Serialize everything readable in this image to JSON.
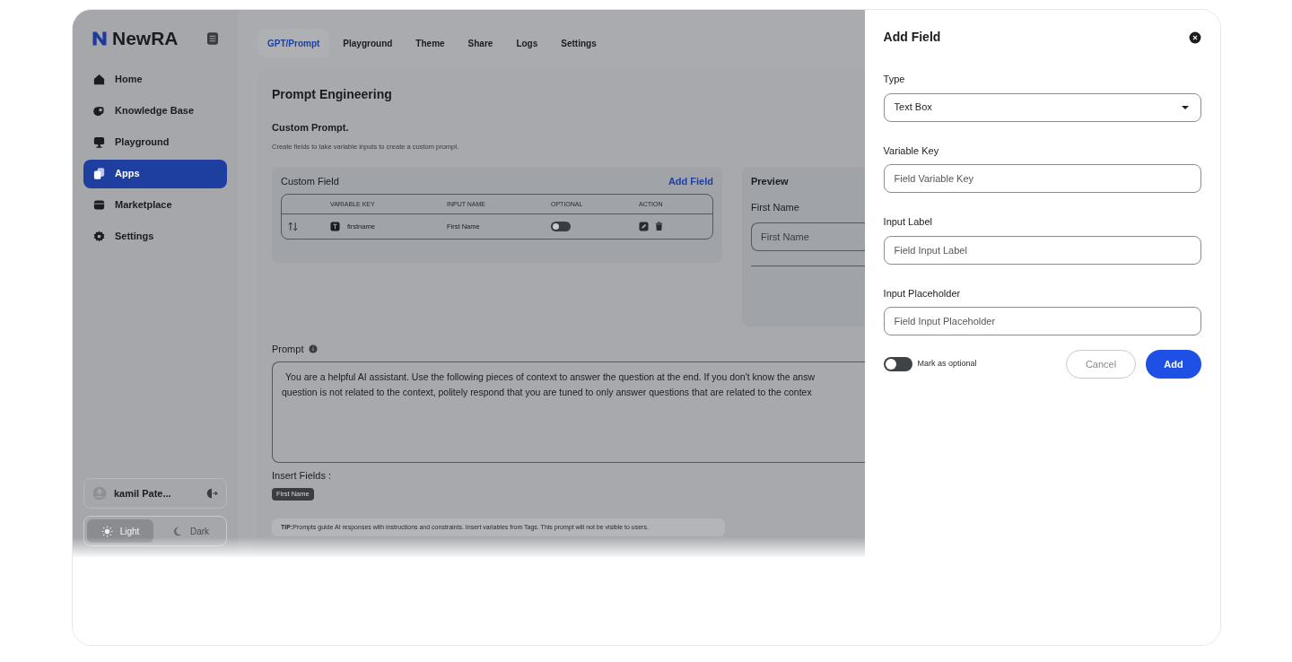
{
  "brand": {
    "name": "NewRA"
  },
  "sidebar": {
    "items": [
      {
        "label": "Home",
        "kind": "home",
        "selected": false
      },
      {
        "label": "Knowledge Base",
        "kind": "book",
        "selected": false
      },
      {
        "label": "Playground",
        "kind": "chat",
        "selected": false
      },
      {
        "label": "Apps",
        "kind": "apps",
        "selected": true
      },
      {
        "label": "Marketplace",
        "kind": "store",
        "selected": false
      },
      {
        "label": "Settings",
        "kind": "gear",
        "selected": false
      }
    ]
  },
  "user": {
    "name": "kamil Pate..."
  },
  "theme_toggle": [
    {
      "label": "Light",
      "kind": "sun",
      "selected": true
    },
    {
      "label": "Dark",
      "kind": "moon",
      "selected": false
    }
  ],
  "tabs": [
    {
      "label": "GPT/Prompt",
      "selected": true
    },
    {
      "label": "Playground",
      "selected": false
    },
    {
      "label": "Theme",
      "selected": false
    },
    {
      "label": "Share",
      "selected": false
    },
    {
      "label": "Logs",
      "selected": false
    },
    {
      "label": "Settings",
      "selected": false
    }
  ],
  "page": {
    "title": "Prompt Engineering",
    "section_title": "Custom Prompt.",
    "section_description": "Create fields to take variable inputs to create a custom prompt."
  },
  "custom_field": {
    "title": "Custom Field",
    "add_link": "Add Field",
    "columns": [
      "VARIABLE KEY",
      "INPUT NAME",
      "OPTIONAL",
      "ACTION"
    ],
    "rows": [
      {
        "variable_key": "firstname",
        "input_name": "First Name",
        "optional": false
      }
    ]
  },
  "preview": {
    "title": "Preview",
    "field_label": "First Name",
    "field_placeholder": "First Name"
  },
  "prompt": {
    "label": "Prompt",
    "lines": [
      "You are a helpful AI assistant. Use the following pieces of context to answer the question at the end. If you don't know the answ",
      "question is not related to the context, politely respond that you are tuned to only answer questions that are related to the contex"
    ]
  },
  "insert_fields": {
    "label": "Insert Fields :",
    "tags": [
      "First Name"
    ]
  },
  "tip": "**TIP:**Prompts guide AI responses with instructions and constraints. Insert variables from Tags. This prompt will not be visible to users.",
  "drawer": {
    "title": "Add Field",
    "fields": [
      {
        "kind": "select",
        "label": "Type",
        "value": "Text Box"
      },
      {
        "kind": "input",
        "label": "Variable Key",
        "placeholder": "Field Variable Key"
      },
      {
        "kind": "input",
        "label": "Input Label",
        "placeholder": "Field Input Label"
      },
      {
        "kind": "input",
        "label": "Input Placeholder",
        "placeholder": "Field Input Placeholder"
      }
    ],
    "optional": {
      "label": "Mark as optional",
      "on": false
    },
    "buttons": {
      "cancel": "Cancel",
      "add": "Add"
    }
  }
}
